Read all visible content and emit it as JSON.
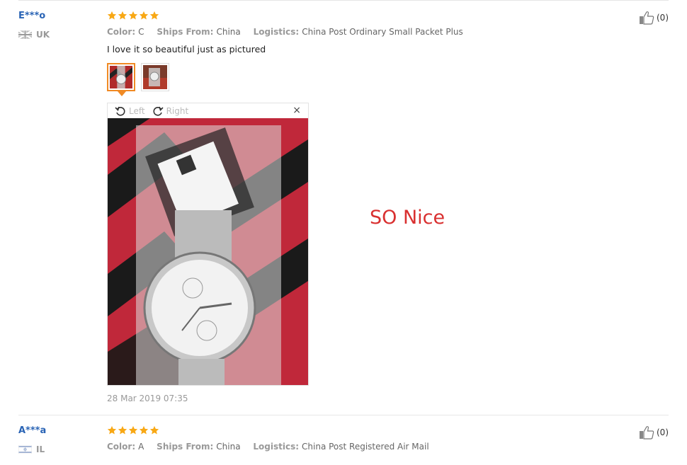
{
  "reviews": [
    {
      "user": "E***o",
      "country": "UK",
      "rating": 5,
      "color_label": "Color:",
      "color_value": "C",
      "ships_label": "Ships From:",
      "ships_value": "China",
      "logistics_label": "Logistics:",
      "logistics_value": "China Post Ordinary Small Packet Plus",
      "text": "I love it so beautiful just as pictured",
      "helpful": "(0)",
      "date": "28 Mar 2019 07:35",
      "viewer": {
        "left": "Left",
        "right": "Right",
        "close": "×"
      },
      "side_caption": "SO Nice"
    },
    {
      "user": "A***a",
      "country": "IL",
      "rating": 5,
      "color_label": "Color:",
      "color_value": "A",
      "ships_label": "Ships From:",
      "ships_value": "China",
      "logistics_label": "Logistics:",
      "logistics_value": "China Post Registered Air Mail",
      "helpful": "(0)"
    }
  ],
  "colors": {
    "username": "#2a64b5",
    "star": "#f8a815",
    "active_thumb": "#f08a24",
    "caption": "#d93030"
  },
  "icons": [
    "uk-flag-icon",
    "israel-flag-icon",
    "star-icon",
    "thumbs-up-icon",
    "rotate-left-icon",
    "rotate-right-icon",
    "close-icon"
  ]
}
